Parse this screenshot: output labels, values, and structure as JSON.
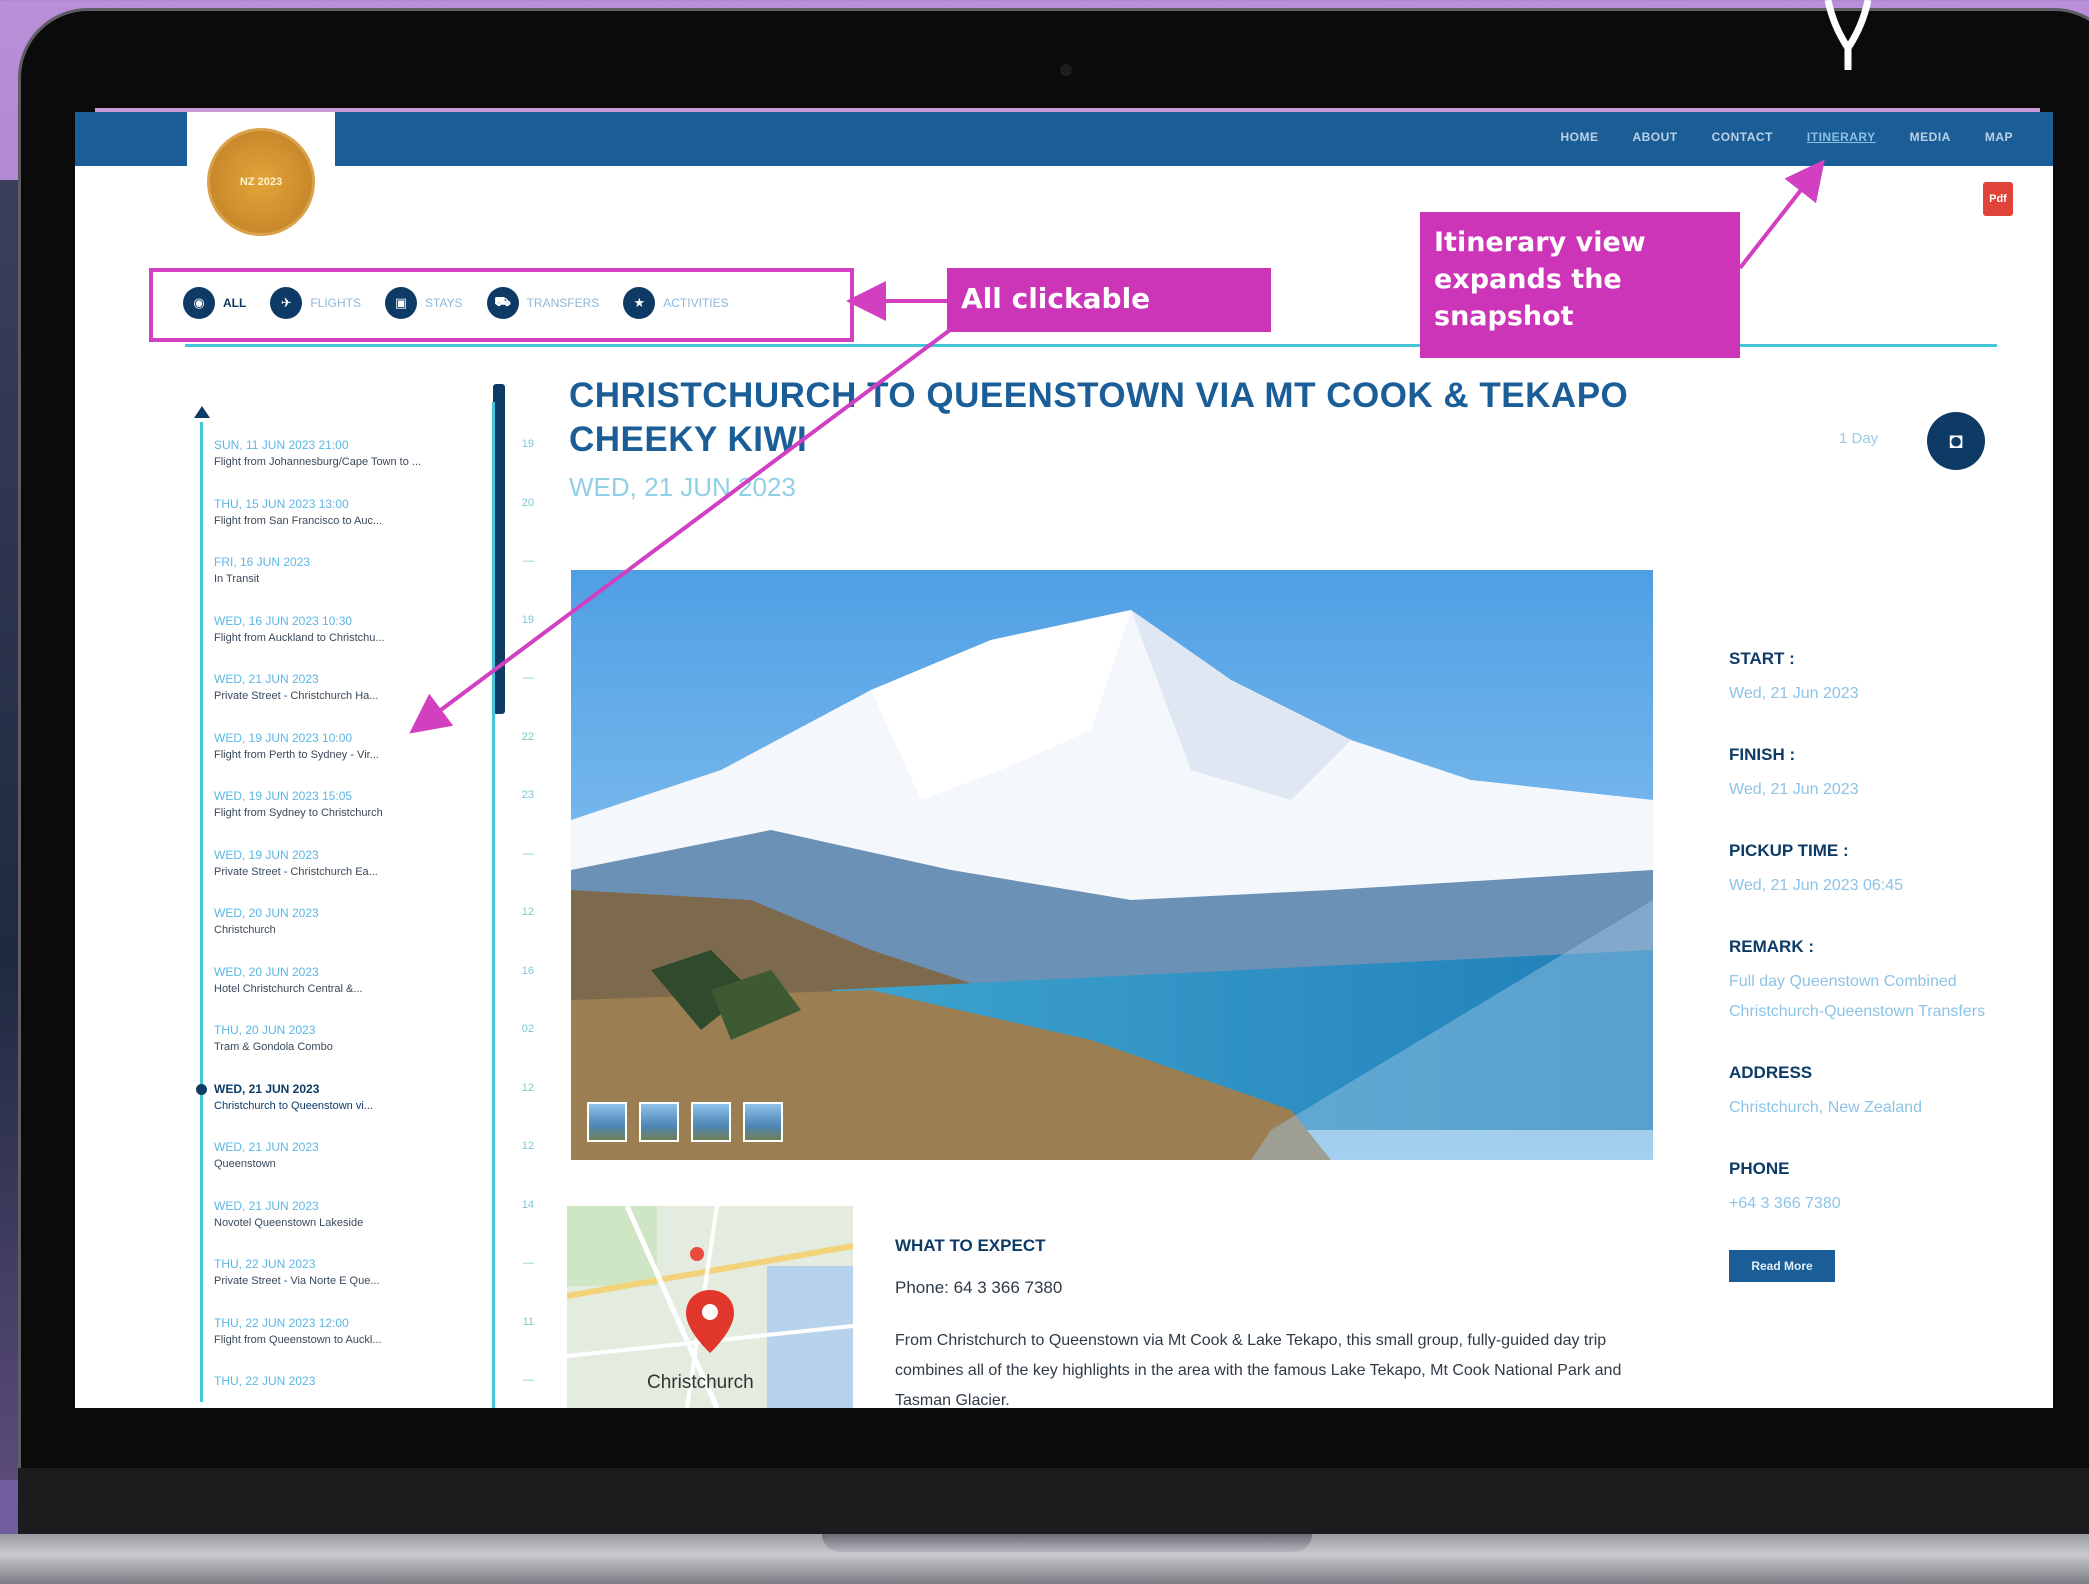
{
  "nav": {
    "items": [
      "HOME",
      "ABOUT",
      "CONTACT",
      "ITINERARY",
      "MEDIA",
      "MAP"
    ],
    "active": "ITINERARY"
  },
  "logo": {
    "text": "NZ 2023"
  },
  "pdf_icon": {
    "label": "Pdf"
  },
  "filters": [
    {
      "icon": "globe-icon",
      "label": "ALL"
    },
    {
      "icon": "plane-icon",
      "label": "FLIGHTS"
    },
    {
      "icon": "hotel-icon",
      "label": "STAYS"
    },
    {
      "icon": "car-icon",
      "label": "TRANSFERS"
    },
    {
      "icon": "activity-icon",
      "label": "ACTIVITIES"
    }
  ],
  "callouts": {
    "all_clickable": "All clickable",
    "itinerary_view": "Itinerary view expands the snapshot"
  },
  "timeline": [
    {
      "date": "SUN, 11 JUN 2023 21:00",
      "text": "Flight from Johannesburg/Cape Town to ...",
      "num": "19"
    },
    {
      "date": "THU, 15 JUN 2023 13:00",
      "text": "Flight from San Francisco to Auc...",
      "num": "20"
    },
    {
      "date": "FRI, 16 JUN 2023",
      "text": "In Transit",
      "num": "—"
    },
    {
      "date": "WED, 16 JUN 2023 10:30",
      "text": "Flight from Auckland to Christchu...",
      "num": "19"
    },
    {
      "date": "WED, 21 JUN 2023",
      "text": "Private Street - Christchurch Ha...",
      "num": "—"
    },
    {
      "date": "WED, 19 JUN 2023 10:00",
      "text": "Flight from Perth to Sydney - Vir...",
      "num": "22"
    },
    {
      "date": "WED, 19 JUN 2023 15:05",
      "text": "Flight from Sydney to Christchurch",
      "num": "23"
    },
    {
      "date": "WED, 19 JUN 2023",
      "text": "Private Street - Christchurch Ea...",
      "num": "—"
    },
    {
      "date": "WED, 20 JUN 2023",
      "text": "Christchurch",
      "num": "12"
    },
    {
      "date": "WED, 20 JUN 2023",
      "text": "Hotel Christchurch Central &...",
      "num": "16"
    },
    {
      "date": "THU, 20 JUN 2023",
      "text": "Tram & Gondola Combo",
      "num": "02"
    },
    {
      "date": "WED, 21 JUN 2023",
      "text": "Christchurch to Queenstown vi...",
      "num": "12",
      "current": true
    },
    {
      "date": "WED, 21 JUN 2023",
      "text": "Queenstown",
      "num": "12"
    },
    {
      "date": "WED, 21 JUN 2023",
      "text": "Novotel Queenstown Lakeside",
      "num": "14"
    },
    {
      "date": "THU, 22 JUN 2023",
      "text": "Private Street - Via Norte E Que...",
      "num": "—"
    },
    {
      "date": "THU, 22 JUN 2023 12:00",
      "text": "Flight from Queenstown to Auckl...",
      "num": "11"
    },
    {
      "date": "THU, 22 JUN 2023",
      "text": "",
      "num": "—"
    }
  ],
  "main": {
    "title": "CHRISTCHURCH TO QUEENSTOWN VIA MT COOK & TEKAPO CHEEKY KIWI",
    "date": "WED, 21 JUN 2023",
    "stay_label": "1 Day",
    "what_to_expect": "WHAT TO EXPECT",
    "phone": "Phone: 64 3 366 7380",
    "description": "From Christchurch to Queenstown via Mt Cook & Lake Tekapo, this small group, fully-guided day trip combines all of the key highlights in the area with the famous Lake Tekapo, Mt Cook National Park and Tasman Glacier."
  },
  "map": {
    "label": "Christchurch"
  },
  "details": [
    {
      "key": "START :",
      "value": "Wed, 21 Jun 2023"
    },
    {
      "key": "FINISH :",
      "value": "Wed, 21 Jun 2023"
    },
    {
      "key": "PICKUP TIME :",
      "value": "Wed, 21 Jun 2023 06:45"
    },
    {
      "key": "REMARK :",
      "value": "Full day Queenstown Combined Christchurch-Queenstown Transfers"
    },
    {
      "key": "ADDRESS",
      "value": "Christchurch, New Zealand"
    },
    {
      "key": "PHONE",
      "value": "+64 3 366 7380"
    }
  ],
  "read_more": "Read More",
  "colors": {
    "topbar": "#1a5d97",
    "navy": "#0d3b66",
    "accent_cyan": "#46c4d8",
    "callout_magenta": "#cc35b8",
    "logo_gold": "#c9892b"
  }
}
